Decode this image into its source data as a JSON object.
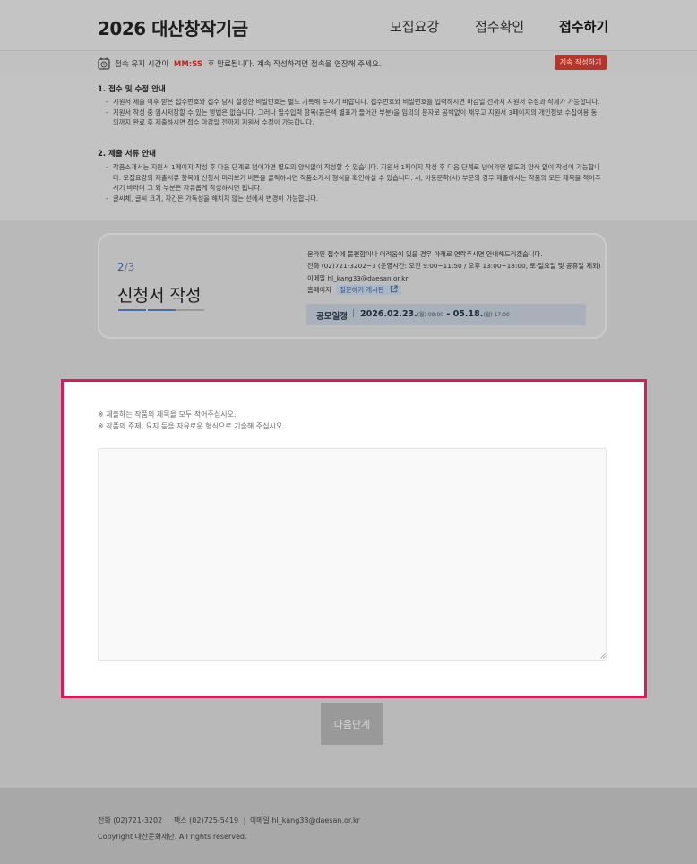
{
  "header": {
    "logo": "2026 대산창작기금",
    "nav": [
      {
        "label": "모집요강"
      },
      {
        "label": "접수확인"
      },
      {
        "label": "접수하기"
      }
    ]
  },
  "timer": {
    "prefix": "접속 유지 시간이",
    "mmss": "MM:SS",
    "suffix": "후 만료됩니다. 계속 작성하려면 접속을 연장해 주세요.",
    "continue_label": "계속 작성하기"
  },
  "notice": {
    "section1_title": "1. 접수 및 수정 안내",
    "section1_items": [
      "지원서 제출 이후 받은 접수번호와 접수 당시 설정한 비밀번호는 별도 기록해 두시기 바랍니다. 접수번호와 비밀번호를 입력하시면 마감일 전까지 지원서 수정과 삭제가 가능합니다.",
      "지원서 작성 중 임시저장할 수 있는 방법은 없습니다. 그러나 필수입력 항목(붉은색 별표가 들어간 부분)을 임의의 문자로 공백없이 채우고 지원서 3페이지의 개인정보 수집이용 동의까지 완료 후 제출하시면 접수 마감일 전까지 지원서 수정이 가능합니다."
    ],
    "section2_title": "2. 제출 서류 안내",
    "section2_items": [
      "작품소개서는 지원서 1페이지 작성 후 다음 단계로 넘어가면 별도의 양식없이 작성할 수 있습니다. 지원서 1페이지 작성 후 다음 단계로 넘어가면 별도의 양식 없이 작성이 가능합니다. 모집요강의 제출서류 항목에 신청서 미리보기 버튼을 클릭하시면 작품소개서 형식을 확인하실 수 있습니다. 시, 아동문학(시) 부문의 경우 제출하시는 작품의 모든 제목을 적어주시기 바라며 그 외 부분은 자유롭게 작성하시면 됩니다.",
      "글씨체, 글씨 크기, 자간은 가독성을 해치지 않는 선에서 변경이 가능합니다."
    ]
  },
  "step": {
    "current": "2",
    "total": "/3",
    "title": "신청서 작성",
    "progress_filled": 2,
    "progress_total": 3
  },
  "contact": {
    "line1": "온라인 접수에 불편함이나 어려움이 있을 경우 아래로 연락주시면 안내해드리겠습니다.",
    "line2": "전화 (02)721-3202~3 (운영시간: 오전 9:00~11:50 / 오후 13:00~18:00, 토·일요일 및 공휴일 제외)",
    "line3": "이메일 hl_kang33@daesan.or.kr",
    "homepage_label": "홈페이지",
    "board_label": "질문하기 게시판"
  },
  "schedule": {
    "label": "공모일정",
    "start_date": "2026.02.23.",
    "start_time": "(월) 09:00",
    "dash": " - ",
    "end_date": "05.18.",
    "end_time": "(월) 17:00"
  },
  "form": {
    "guide1": "※ 제출하는 작품의 제목을 모두 적어주십시오.",
    "guide2": "※ 작품의 주제, 요지 등을 자유로운 형식으로 기술해 주십시오.",
    "content_value": ""
  },
  "next_button": "다음단계",
  "footer": {
    "phone": "전화 (02)721-3202",
    "fax": "팩스 (02)725-5419",
    "email": "이메일 hl_kang33@daesan.or.kr",
    "copyright": "Copyright 대산문화재단. All rights reserved."
  },
  "colors": {
    "highlight_border": "#d81b5c",
    "timer_accent": "#c8231e",
    "step_accent": "#2e5da9"
  }
}
